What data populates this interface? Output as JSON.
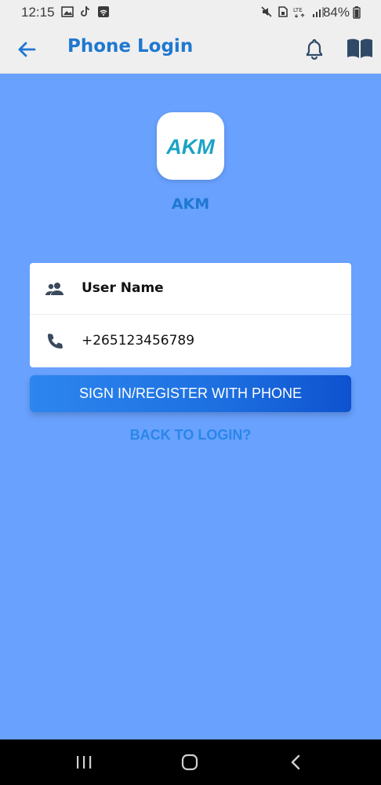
{
  "status_bar": {
    "time": "12:15",
    "battery": "84%",
    "network": "LTE"
  },
  "app_bar": {
    "title": "Phone Login"
  },
  "logo": {
    "name": "AKM",
    "mark_text": "AKM"
  },
  "form": {
    "username": {
      "value": "User Name"
    },
    "phone": {
      "value": "+265123456789"
    }
  },
  "buttons": {
    "sign_in": "SIGN IN/REGISTER WITH PHONE",
    "back_to_login": "BACK TO LOGIN?"
  },
  "icons": {
    "back": "arrow-left-icon",
    "bell": "bell-icon",
    "book": "book-icon",
    "user": "group-icon",
    "phone": "phone-icon"
  },
  "colors": {
    "accent": "#1f78d1",
    "background": "#68a1fe",
    "button": "#1d6fe0"
  }
}
